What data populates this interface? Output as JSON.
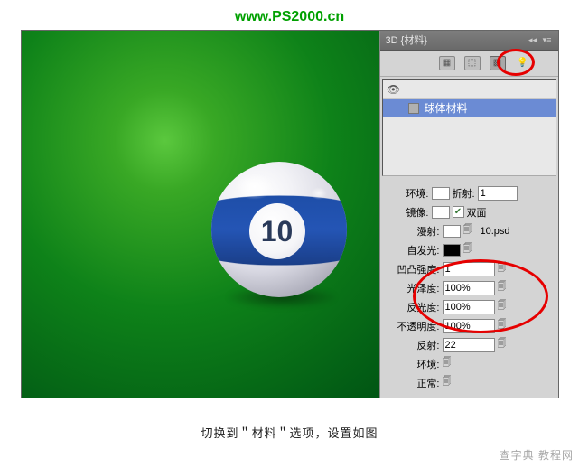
{
  "url_watermark": "www.PS2000.cn",
  "panel": {
    "title": "3D {材料}",
    "layer": {
      "name": "球体材料"
    }
  },
  "ball_number": "10",
  "properties": {
    "env_label": "环境:",
    "refract_label": "折射:",
    "refract_value": "1",
    "mirror_label": "镜像:",
    "double_sided": "双面",
    "diffuse_label": "漫射:",
    "diffuse_file": "10.psd",
    "self_illum_label": "自发光:",
    "bump_label": "凹凸强度:",
    "bump_value": "1",
    "gloss_label": "光泽度:",
    "gloss_value": "100%",
    "reflectivity_label": "反光度:",
    "reflectivity_value": "100%",
    "opacity_label": "不透明度:",
    "opacity_value": "100%",
    "reflection_label": "反射:",
    "reflection_value": "22",
    "env2_label": "环境:",
    "normal_label": "正常:"
  },
  "caption": "切换到＂材料＂选项，设置如图",
  "footer_watermark": "查字典 教程网"
}
